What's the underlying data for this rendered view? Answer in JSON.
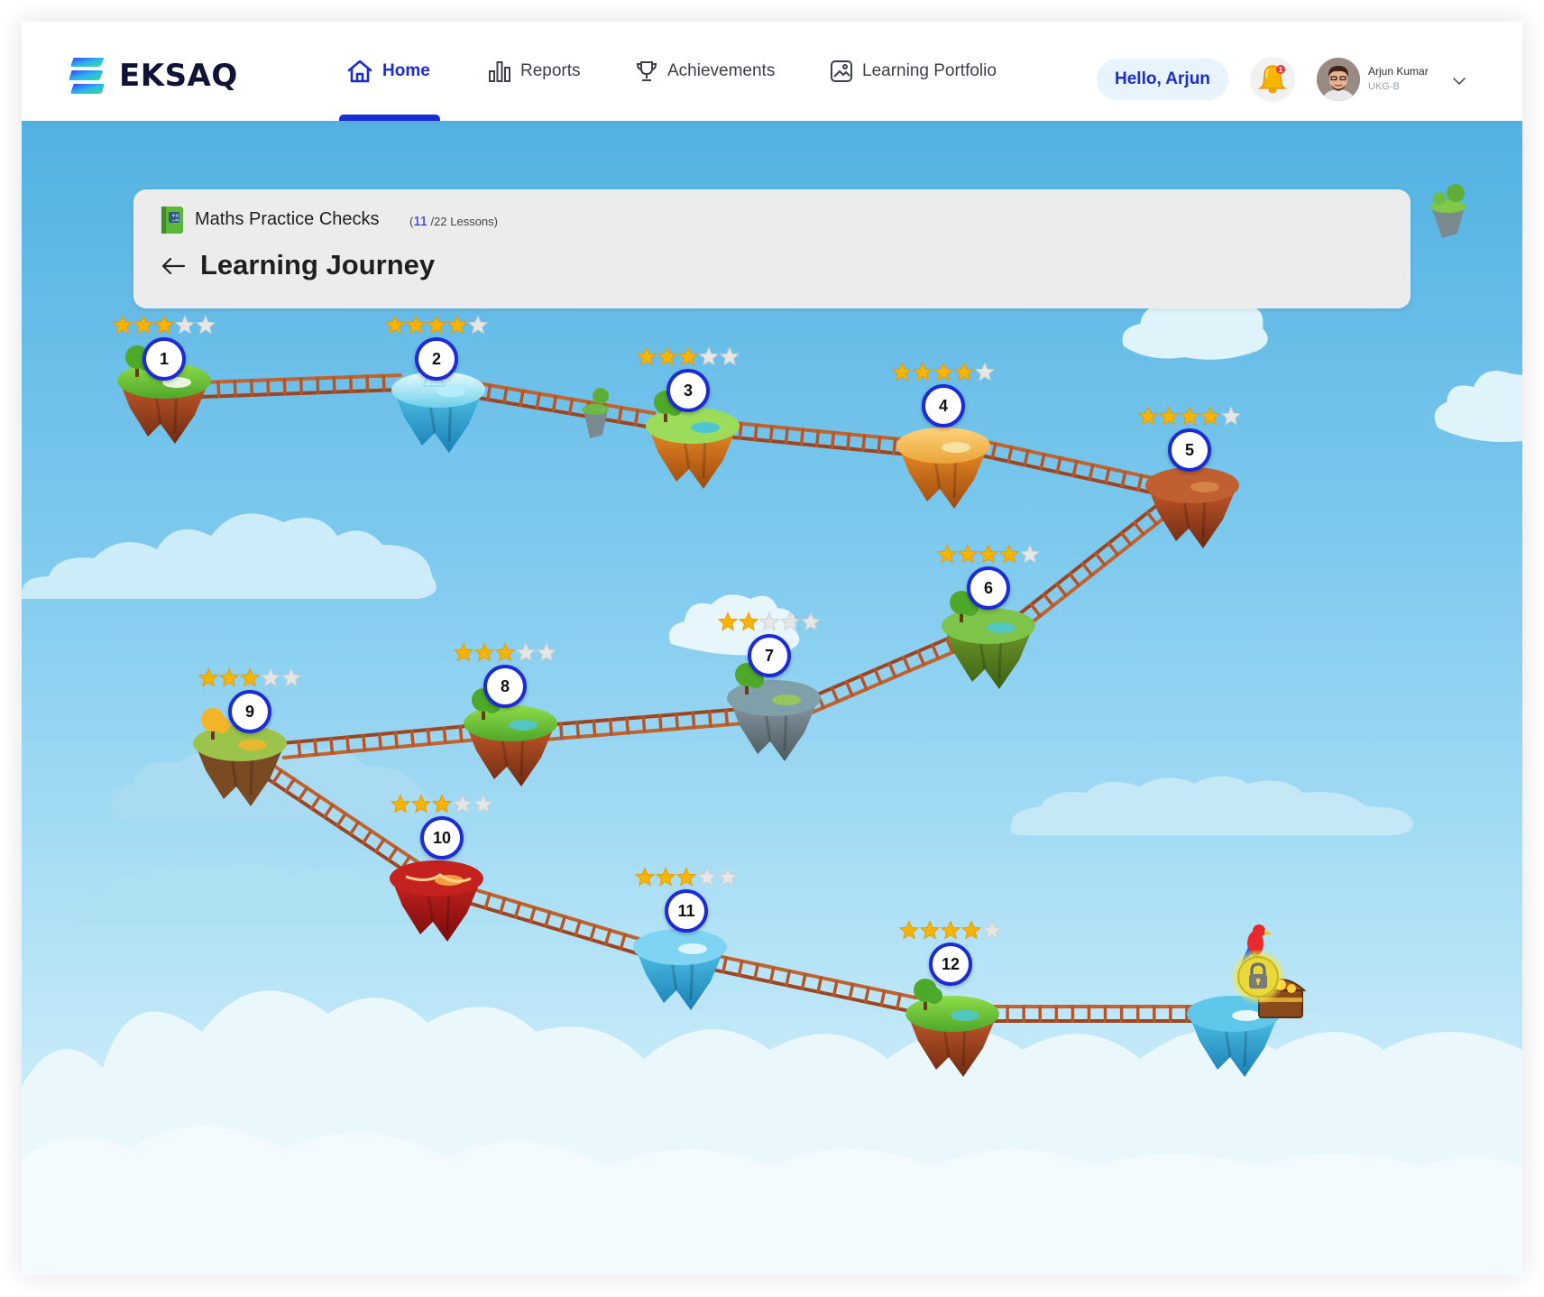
{
  "app": {
    "brand": "EKSAQ"
  },
  "nav": {
    "items": [
      {
        "label": "Home",
        "icon": "home-icon",
        "active": true
      },
      {
        "label": "Reports",
        "icon": "bar-chart-icon",
        "active": false
      },
      {
        "label": "Achievements",
        "icon": "trophy-icon",
        "active": false
      },
      {
        "label": "Learning Portfolio",
        "icon": "portfolio-icon",
        "active": false
      }
    ]
  },
  "user": {
    "greeting": "Hello, Arjun",
    "name": "Arjun Kumar",
    "class": "UKG-B",
    "notifications": "1"
  },
  "journey": {
    "course_title": "Maths Practice Checks",
    "lessons_done": "11",
    "lessons_total": "/22 Lessons",
    "progress_open": "(",
    "progress_close": ")",
    "page_title": "Learning Journey"
  },
  "levels": [
    {
      "number": "1",
      "stars": 3,
      "max_stars": 5,
      "biome": "meadow"
    },
    {
      "number": "2",
      "stars": 4,
      "max_stars": 5,
      "biome": "ice"
    },
    {
      "number": "3",
      "stars": 3,
      "max_stars": 5,
      "biome": "tropical"
    },
    {
      "number": "4",
      "stars": 4,
      "max_stars": 5,
      "biome": "desert"
    },
    {
      "number": "5",
      "stars": 4,
      "max_stars": 5,
      "biome": "canyon"
    },
    {
      "number": "6",
      "stars": 4,
      "max_stars": 5,
      "biome": "swamp"
    },
    {
      "number": "7",
      "stars": 2,
      "max_stars": 5,
      "biome": "rock"
    },
    {
      "number": "8",
      "stars": 3,
      "max_stars": 5,
      "biome": "forest"
    },
    {
      "number": "9",
      "stars": 3,
      "max_stars": 5,
      "biome": "autumn"
    },
    {
      "number": "10",
      "stars": 3,
      "max_stars": 5,
      "biome": "lava"
    },
    {
      "number": "11",
      "stars": 3,
      "max_stars": 5,
      "biome": "glacier"
    },
    {
      "number": "12",
      "stars": 4,
      "max_stars": 5,
      "biome": "jungle"
    },
    {
      "number": "",
      "stars": 0,
      "max_stars": 0,
      "biome": "treasure",
      "locked": true
    }
  ],
  "colors": {
    "accent": "#1b2bd6",
    "star_filled": "#f7b500",
    "star_empty": "#e6e6e6",
    "ladder": "#b5562a",
    "sky_top": "#52b1e2",
    "sky_bottom": "#e4f6fd",
    "card_bg": "#ececec",
    "lock_glow": "#f3e64a"
  }
}
